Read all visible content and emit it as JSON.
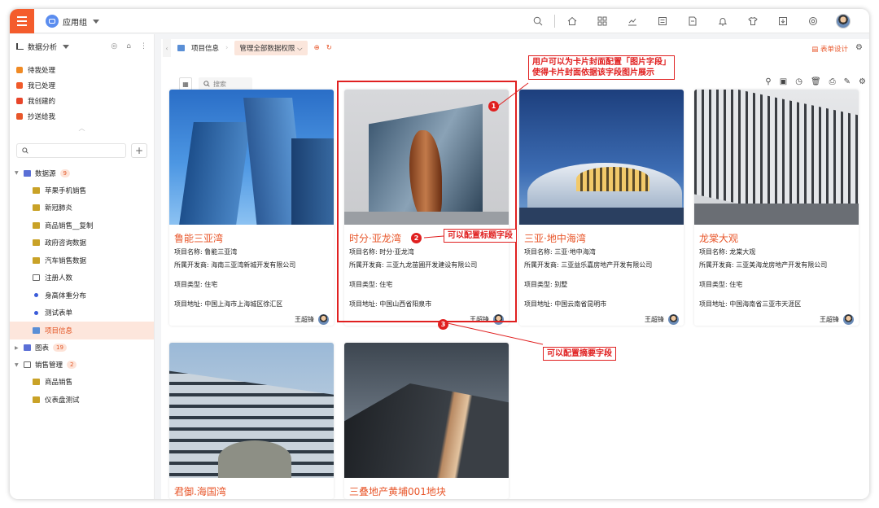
{
  "topbar": {
    "app_group": "应用组",
    "icons": [
      "search-icon",
      "home-icon",
      "grid-icon",
      "trend-icon",
      "list-icon",
      "doc-icon",
      "bell-icon",
      "shirt-icon",
      "download-icon",
      "target-icon"
    ]
  },
  "sidebar": {
    "title": "数据分析",
    "quick": [
      {
        "label": "待我处理",
        "color": "#f08a24"
      },
      {
        "label": "我已处理",
        "color": "#f05a2a"
      },
      {
        "label": "我创建的",
        "color": "#e8452a"
      },
      {
        "label": "抄送给我",
        "color": "#e8562a"
      }
    ],
    "search_placeholder": "",
    "groups": [
      {
        "label": "数据源",
        "badge": "9",
        "expanded": true,
        "items": [
          {
            "label": "苹果手机销售",
            "active": false
          },
          {
            "label": "新冠肺炎",
            "active": false
          },
          {
            "label": "商品销售__复制",
            "active": false
          },
          {
            "label": "政府咨询数据",
            "active": false
          },
          {
            "label": "汽车销售数据",
            "active": false
          },
          {
            "label": "注册人数",
            "active": false
          },
          {
            "label": "身高体重分布",
            "active": false
          },
          {
            "label": "测试表单",
            "active": false
          },
          {
            "label": "项目信息",
            "active": true
          }
        ]
      },
      {
        "label": "图表",
        "badge": "19",
        "expanded": false,
        "items": []
      },
      {
        "label": "销售管理",
        "badge": "2",
        "expanded": true,
        "items": [
          {
            "label": "商品销售",
            "active": false
          },
          {
            "label": "仪表盘测试",
            "active": false
          }
        ]
      }
    ]
  },
  "content": {
    "tab_label": "项目信息",
    "permission_label": "管理全部数据权限",
    "form_design": "表单设计",
    "search_placeholder": "搜索"
  },
  "cards": [
    {
      "title": "鲁能三亚湾",
      "name_label": "项目名称:",
      "name": "鲁能三亚湾",
      "dev_label": "所属开发商:",
      "developer": "海南三亚湾新城开发有限公司",
      "type_label": "项目类型:",
      "type": "住宅",
      "addr_label": "项目地址:",
      "address": "中国上海市上海城区徐汇区",
      "owner": "王超锋"
    },
    {
      "title": "时分·亚龙湾",
      "name_label": "项目名称:",
      "name": "时分·亚龙湾",
      "dev_label": "所属开发商:",
      "developer": "三亚九龙苗圃开发建设有限公司",
      "type_label": "项目类型:",
      "type": "住宅",
      "addr_label": "项目地址:",
      "address": "中国山西省阳泉市",
      "owner": "王超锋"
    },
    {
      "title": "三亚·地中海湾",
      "name_label": "项目名称:",
      "name": "三亚·地中海湾",
      "dev_label": "所属开发商:",
      "developer": "三亚益乐嘉房地产开发有限公司",
      "type_label": "项目类型:",
      "type": "别墅",
      "addr_label": "项目地址:",
      "address": "中国云南省昆明市",
      "owner": "王超锋"
    },
    {
      "title": "龙棠大观",
      "name_label": "项目名称:",
      "name": "龙棠大观",
      "dev_label": "所属开发商:",
      "developer": "三亚美海龙房地产开发有限公司",
      "type_label": "项目类型:",
      "type": "住宅",
      "addr_label": "项目地址:",
      "address": "中国海南省三亚市天涯区",
      "owner": "王超锋"
    },
    {
      "title": "君御.海国湾"
    },
    {
      "title": "三叠地产黄埔001地块"
    }
  ],
  "annotations": {
    "callout1_line1": "用户可以为卡片封面配置「图片字段」",
    "callout1_line2": "使得卡片封面依据该字段图片展示",
    "callout2": "可以配置标题字段",
    "callout3": "可以配置摘要字段",
    "n1": "1",
    "n2": "2",
    "n3": "3",
    "color": "#e02020"
  }
}
